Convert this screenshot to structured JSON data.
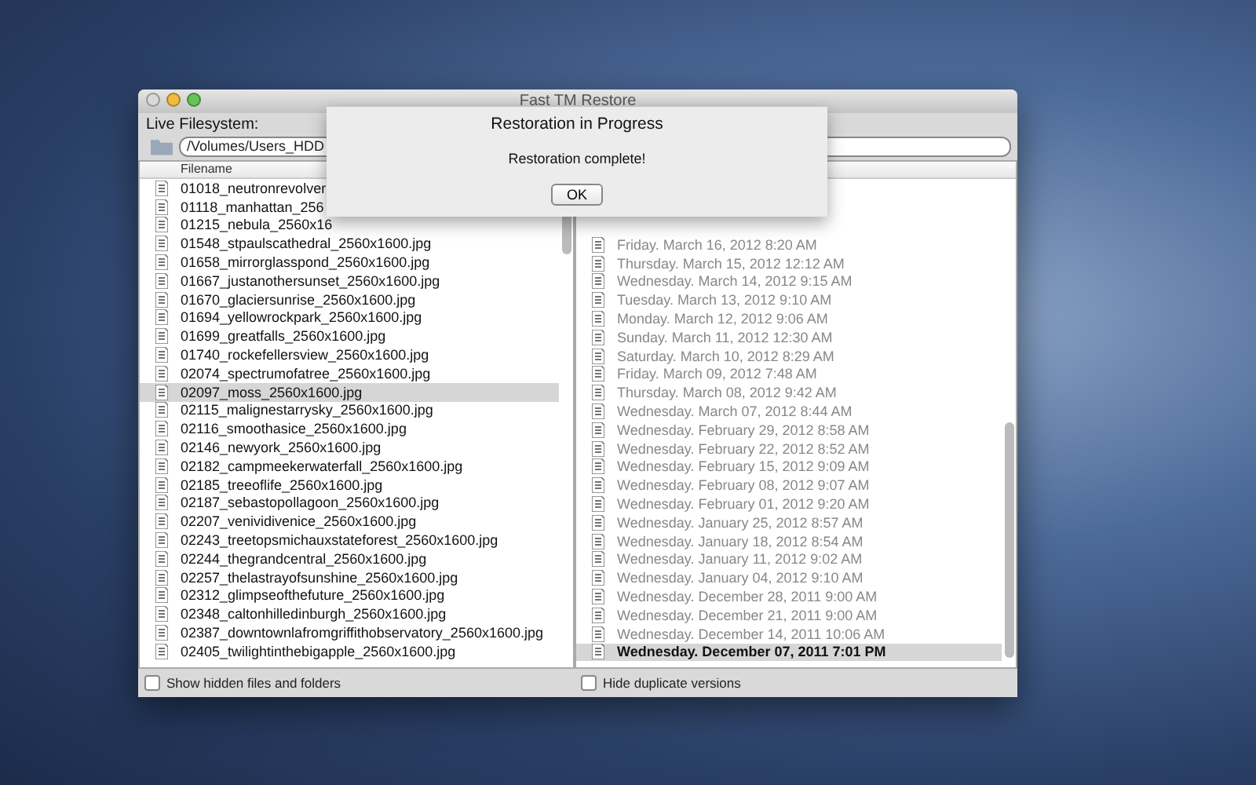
{
  "window": {
    "title": "Fast TM Restore"
  },
  "left": {
    "label": "Live Filesystem:",
    "path": "/Volumes/Users_HDD",
    "column": "Filename",
    "rows": [
      {
        "name": "01018_neutronrevolver",
        "selected": false
      },
      {
        "name": "01118_manhattan_256",
        "selected": false
      },
      {
        "name": "01215_nebula_2560x16",
        "selected": false
      },
      {
        "name": "01548_stpaulscathedral_2560x1600.jpg",
        "selected": false
      },
      {
        "name": "01658_mirrorglasspond_2560x1600.jpg",
        "selected": false
      },
      {
        "name": "01667_justanothersunset_2560x1600.jpg",
        "selected": false
      },
      {
        "name": "01670_glaciersunrise_2560x1600.jpg",
        "selected": false
      },
      {
        "name": "01694_yellowrockpark_2560x1600.jpg",
        "selected": false
      },
      {
        "name": "01699_greatfalls_2560x1600.jpg",
        "selected": false
      },
      {
        "name": "01740_rockefellersview_2560x1600.jpg",
        "selected": false
      },
      {
        "name": "02074_spectrumofatree_2560x1600.jpg",
        "selected": false
      },
      {
        "name": "02097_moss_2560x1600.jpg",
        "selected": true
      },
      {
        "name": "02115_malignestarrysky_2560x1600.jpg",
        "selected": false
      },
      {
        "name": "02116_smoothasice_2560x1600.jpg",
        "selected": false
      },
      {
        "name": "02146_newyork_2560x1600.jpg",
        "selected": false
      },
      {
        "name": "02182_campmeekerwaterfall_2560x1600.jpg",
        "selected": false
      },
      {
        "name": "02185_treeoflife_2560x1600.jpg",
        "selected": false
      },
      {
        "name": "02187_sebastopollagoon_2560x1600.jpg",
        "selected": false
      },
      {
        "name": "02207_venividivenice_2560x1600.jpg",
        "selected": false
      },
      {
        "name": "02243_treetopsmichauxstateforest_2560x1600.jpg",
        "selected": false
      },
      {
        "name": "02244_thegrandcentral_2560x1600.jpg",
        "selected": false
      },
      {
        "name": "02257_thelastrayofsunshine_2560x1600.jpg",
        "selected": false
      },
      {
        "name": "02312_glimpseofthefuture_2560x1600.jpg",
        "selected": false
      },
      {
        "name": "02348_caltonhilledinburgh_2560x1600.jpg",
        "selected": false
      },
      {
        "name": "02387_downtownlafromgriffithobservatory_2560x1600.jpg",
        "selected": false
      },
      {
        "name": "02405_twilightinthebigapple_2560x1600.jpg",
        "selected": false
      }
    ],
    "checkbox": {
      "label": "Show hidden files and folders",
      "checked": false
    }
  },
  "right": {
    "rows": [
      {
        "date": "Friday. March 16, 2012 8:20 AM",
        "selected": false
      },
      {
        "date": "Thursday. March 15, 2012 12:12 AM",
        "selected": false
      },
      {
        "date": "Wednesday. March 14, 2012 9:15 AM",
        "selected": false
      },
      {
        "date": "Tuesday. March 13, 2012 9:10 AM",
        "selected": false
      },
      {
        "date": "Monday. March 12, 2012 9:06 AM",
        "selected": false
      },
      {
        "date": "Sunday. March 11, 2012 12:30 AM",
        "selected": false
      },
      {
        "date": "Saturday. March 10, 2012 8:29 AM",
        "selected": false
      },
      {
        "date": "Friday. March 09, 2012 7:48 AM",
        "selected": false
      },
      {
        "date": "Thursday. March 08, 2012 9:42 AM",
        "selected": false
      },
      {
        "date": "Wednesday. March 07, 2012 8:44 AM",
        "selected": false
      },
      {
        "date": "Wednesday. February 29, 2012 8:58 AM",
        "selected": false
      },
      {
        "date": "Wednesday. February 22, 2012 8:52 AM",
        "selected": false
      },
      {
        "date": "Wednesday. February 15, 2012 9:09 AM",
        "selected": false
      },
      {
        "date": "Wednesday. February 08, 2012 9:07 AM",
        "selected": false
      },
      {
        "date": "Wednesday. February 01, 2012 9:20 AM",
        "selected": false
      },
      {
        "date": "Wednesday. January 25, 2012 8:57 AM",
        "selected": false
      },
      {
        "date": "Wednesday. January 18, 2012 8:54 AM",
        "selected": false
      },
      {
        "date": "Wednesday. January 11, 2012 9:02 AM",
        "selected": false
      },
      {
        "date": "Wednesday. January 04, 2012 9:10 AM",
        "selected": false
      },
      {
        "date": "Wednesday. December 28, 2011 9:00 AM",
        "selected": false
      },
      {
        "date": "Wednesday. December 21, 2011 9:00 AM",
        "selected": false
      },
      {
        "date": "Wednesday. December 14, 2011 10:06 AM",
        "selected": false
      },
      {
        "date": "Wednesday. December 07, 2011 7:01 PM",
        "selected": true
      }
    ],
    "checkbox": {
      "label": "Hide duplicate versions",
      "checked": false
    }
  },
  "dialog": {
    "title": "Restoration in Progress",
    "message": "Restoration complete!",
    "button": "OK"
  }
}
